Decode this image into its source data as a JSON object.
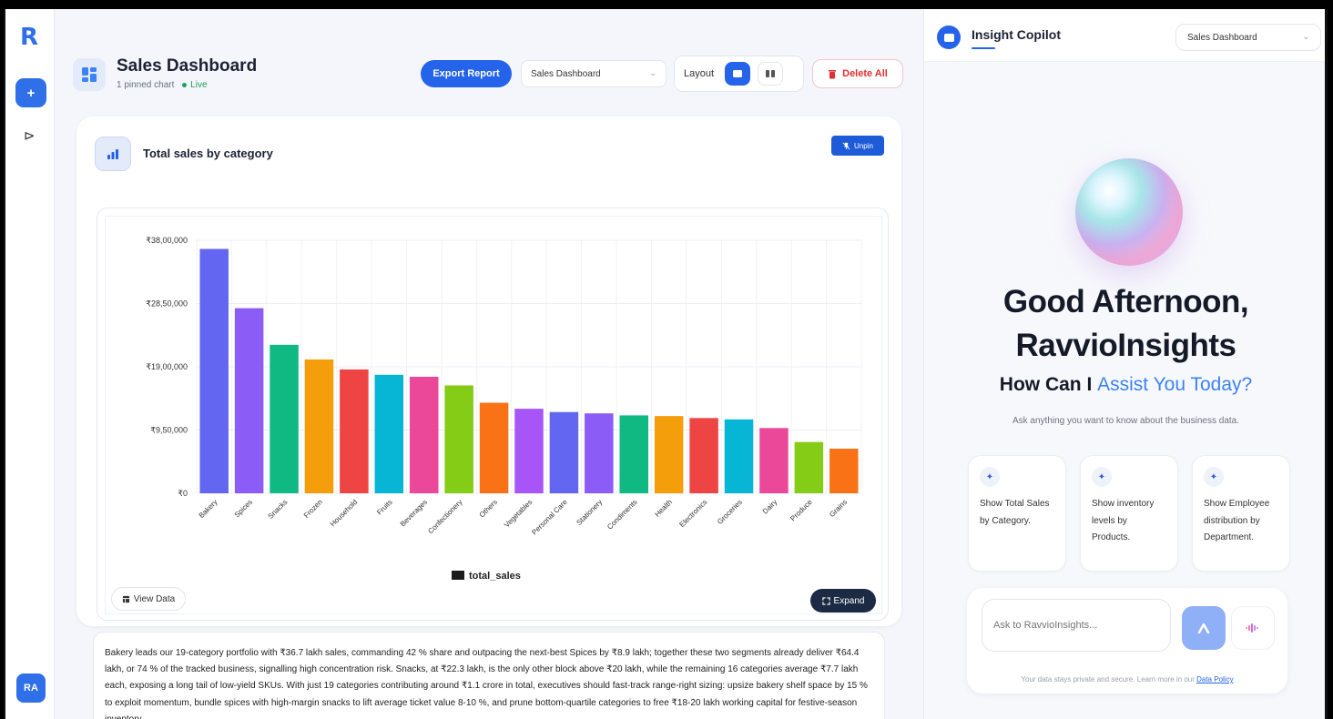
{
  "rail": {
    "logo": "R",
    "new_label": "+",
    "expand_label": "⊳",
    "avatar": "RA"
  },
  "header": {
    "title": "Sales Dashboard",
    "pinned": "1 pinned chart",
    "status": "Live",
    "export_label": "Export Report",
    "dashboard_select": "Sales Dashboard",
    "layout_label": "Layout",
    "delete_label": "Delete All"
  },
  "card": {
    "title": "Total sales by category",
    "unpin_label": "Unpin",
    "view_data_label": "View Data",
    "expand_label": "Expand"
  },
  "chart_data": {
    "type": "bar",
    "categories": [
      "Bakery",
      "Spices",
      "Snacks",
      "Frozen",
      "Household",
      "Fruits",
      "Beverages",
      "Confectionery",
      "Others",
      "Vegetables",
      "Personal Care",
      "Stationery",
      "Condiments",
      "Health",
      "Electronics",
      "Groceries",
      "Dairy",
      "Produce",
      "Grains"
    ],
    "series": [
      {
        "name": "total_sales",
        "values": [
          3670000,
          2780000,
          2230000,
          2010000,
          1860000,
          1780000,
          1750000,
          1620000,
          1360000,
          1270000,
          1220000,
          1200000,
          1170000,
          1160000,
          1130000,
          1110000,
          980000,
          770000,
          670000
        ]
      }
    ],
    "colors": [
      "#6366f1",
      "#8b5cf6",
      "#10b981",
      "#f59e0b",
      "#ef4444",
      "#06b6d4",
      "#ec4899",
      "#84cc16",
      "#f97316",
      "#a855f7",
      "#6366f1",
      "#8b5cf6",
      "#10b981",
      "#f59e0b",
      "#ef4444",
      "#06b6d4",
      "#ec4899",
      "#84cc16",
      "#f97316"
    ],
    "y_ticks": [
      "₹0",
      "₹9,50,000",
      "₹19,00,000",
      "₹28,50,000",
      "₹38,00,000"
    ],
    "y_tick_values": [
      0,
      950000,
      1900000,
      2850000,
      3800000
    ],
    "ylim": [
      0,
      3800000
    ],
    "legend": "total_sales",
    "legend_position": "bottom",
    "grid": true
  },
  "insight": {
    "text": "Bakery leads our 19-category portfolio with ₹36.7 lakh sales, commanding 42 % share and outpacing the next-best Spices by ₹8.9 lakh; together these two segments already deliver ₹64.4 lakh, or 74 % of the tracked business, signalling high concentration risk. Snacks, at ₹22.3 lakh, is the only other block above ₹20 lakh, while the remaining 16 categories average ₹7.7 lakh each, exposing a long tail of low-yield SKUs. With just 19 categories contributing around ₹1.1 crore in total, executives should fast-track range-right sizing: upsize bakery shelf space by 15 % to exploit momentum, bundle spices with high-margin snacks to lift average ticket value 8-10 %, and prune bottom-quartile categories to free ₹18-20 lakh working capital for festive-season inventory."
  },
  "copilot": {
    "title": "Insight Copilot",
    "dashboard_select": "Sales Dashboard",
    "greeting_line1": "Good Afternoon,",
    "greeting_line2": "RavvioInsights",
    "assist_prefix": "How Can I ",
    "assist_accent": "Assist You Today?",
    "hint": "Ask anything you want to know about the business data.",
    "suggestions": [
      {
        "text": "Show Total Sales by Category."
      },
      {
        "text": "Show inventory levels by Products."
      },
      {
        "text": "Show Employee distribution by Department."
      }
    ],
    "ask_placeholder": "Ask to RavvioInsights...",
    "privacy_text": "Your data stays private and secure. Learn more in our ",
    "privacy_link": "Data Policy"
  },
  "colors": {
    "accent": "#2563eb",
    "danger": "#e03131",
    "live": "#1aa35b"
  }
}
